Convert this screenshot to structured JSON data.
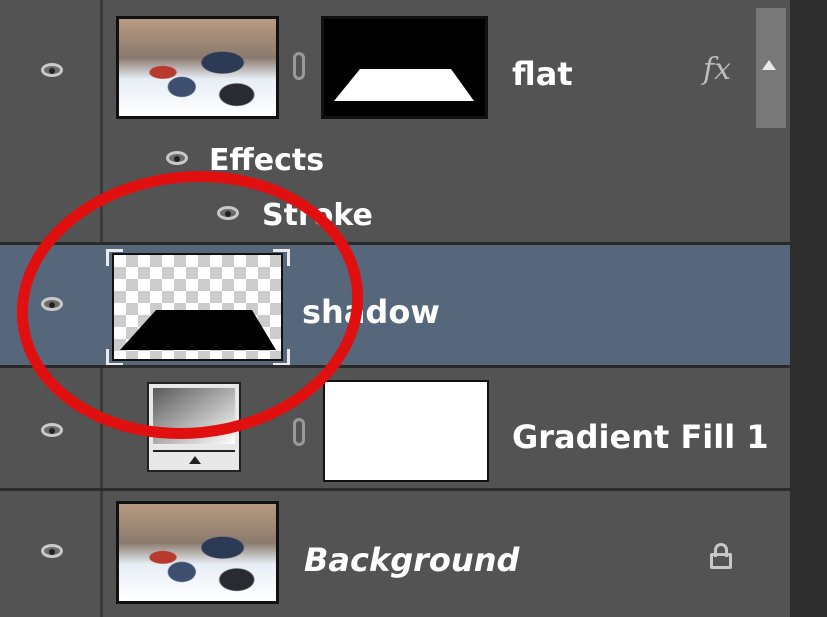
{
  "layers": [
    {
      "name": "flat",
      "has_fx": true,
      "fx_label": "fx"
    },
    {
      "name": "shadow",
      "selected": true
    },
    {
      "name": "Gradient Fill 1"
    },
    {
      "name": "Background",
      "locked": true
    }
  ],
  "effects": {
    "group_label": "Effects",
    "items": [
      "Stroke"
    ]
  },
  "colors": {
    "panel_bg": "#535353",
    "selected_row": "#56667b",
    "annotation": "#e01010"
  }
}
